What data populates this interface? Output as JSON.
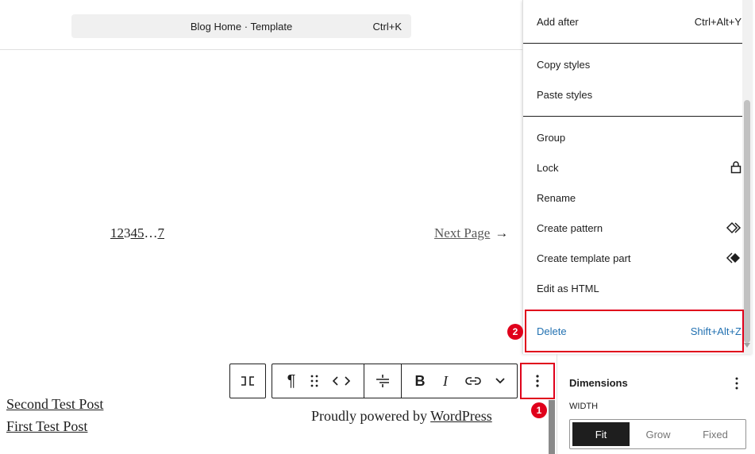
{
  "command_bar": {
    "title": "Blog Home · Template",
    "shortcut": "Ctrl+K"
  },
  "pagination": {
    "numbers": [
      "1",
      "2",
      "3",
      "4",
      "5",
      "…",
      "7"
    ],
    "next_label": "Next Page",
    "next_arrow": "→"
  },
  "footer": {
    "posts": [
      "Second Test Post",
      "First Test Post"
    ],
    "powered_prefix": "Proudly powered by ",
    "powered_link": "WordPress"
  },
  "block_toolbar": {
    "icons": [
      "parent-block-icon",
      "paragraph-icon",
      "drag-handle-icon",
      "move-arrows-icon",
      "align-icon",
      "bold-icon",
      "italic-icon",
      "link-icon",
      "more-rich-text-icon",
      "options-icon"
    ],
    "bold_label": "B",
    "italic_label": "I",
    "paragraph_label": "¶"
  },
  "menu": {
    "items": [
      {
        "label": "Add after",
        "shortcut": "Ctrl+Alt+Y"
      },
      {
        "label": "Copy styles",
        "shortcut": ""
      },
      {
        "label": "Paste styles",
        "shortcut": ""
      },
      {
        "label": "Group",
        "shortcut": ""
      },
      {
        "label": "Lock",
        "icon": "lock-icon"
      },
      {
        "label": "Rename",
        "shortcut": ""
      },
      {
        "label": "Create pattern",
        "icon": "pattern-icon"
      },
      {
        "label": "Create template part",
        "icon": "template-part-icon"
      },
      {
        "label": "Edit as HTML",
        "shortcut": ""
      },
      {
        "label": "Delete",
        "shortcut": "Shift+Alt+Z"
      }
    ],
    "delete_color": "#2271b1"
  },
  "annotations": {
    "badge_1": "1",
    "badge_2": "2",
    "highlight_color": "#e0001b"
  },
  "inspector": {
    "section_title": "Dimensions",
    "width_label": "WIDTH",
    "width_options": [
      "Fit",
      "Grow",
      "Fixed"
    ],
    "width_selected": "Fit"
  }
}
